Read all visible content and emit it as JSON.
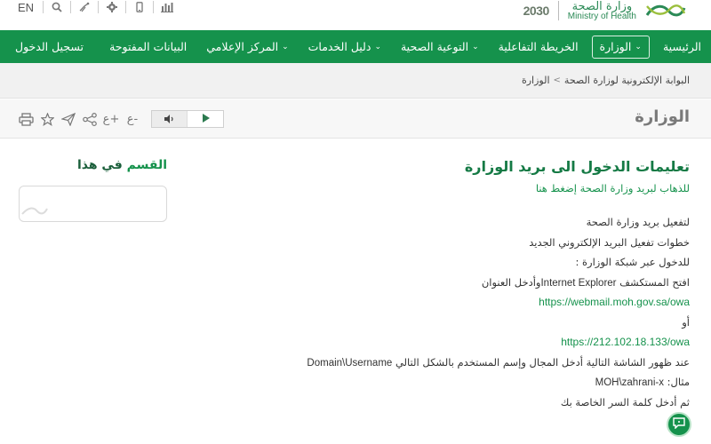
{
  "topbar": {
    "lang": "EN",
    "icons": [
      "search-icon",
      "accessibility-icon",
      "gear-icon",
      "mobile-icon",
      "stats-icon"
    ],
    "vision": "2030",
    "ministry_ar": "وزارة الصحة",
    "ministry_en": "Ministry of Health"
  },
  "nav": {
    "items": [
      {
        "label": "الرئيسية"
      },
      {
        "label": "الوزارة",
        "chev": "⌄"
      },
      {
        "label": "الخريطة التفاعلية"
      },
      {
        "label": "التوعية الصحية",
        "chev": "⌄"
      },
      {
        "label": "دليل الخدمات",
        "chev": "⌄"
      },
      {
        "label": "المركز الإعلامي",
        "chev": "⌄"
      },
      {
        "label": "البيانات المفتوحة"
      }
    ],
    "login": "تسجيل الدخول"
  },
  "breadcrumb": {
    "items": [
      "البوابة الإلكترونية لوزارة الصحة",
      "الوزارة"
    ]
  },
  "page": {
    "title": "الوزارة"
  },
  "tools": {
    "icons": [
      "print-icon",
      "star-icon",
      "send-icon",
      "share-icon",
      "font-increase-icon",
      "font-decrease-icon"
    ],
    "font_up": "ع+",
    "font_down": "ع-"
  },
  "sidebar": {
    "title_a": "في هذا",
    "title_b": "القسم"
  },
  "article": {
    "title": "تعليمات الدخول الى بريد الوزارة",
    "link": "للذهاب لبريد وزارة الصحة إضغط هنا",
    "lines": [
      "لتفعيل بريد وزارة الصحة",
      "خطوات تفعيل البريد الإلكتروني الجديد",
      "للدخول عبر شبكة الوزارة :"
    ],
    "ie_pre": "افتح المستكشف ",
    "ie_name": "Internet Explorer",
    "ie_post": "وأدخل العنوان",
    "url1": "https://webmail.moh.gov.sa/owa",
    "or": "أو",
    "url2": "https://212.102.18.133/owa",
    "instr_pre": "عند ظهور الشاشة التالية أدخل المجال وإسم المستخدم بالشكل التالي ",
    "instr_fmt": "Domain\\Username",
    "example_label": "مثال: ",
    "example_value": "MOH\\zahrani-x",
    "password": "ثم أدخل كلمة السر الخاصة بك"
  }
}
